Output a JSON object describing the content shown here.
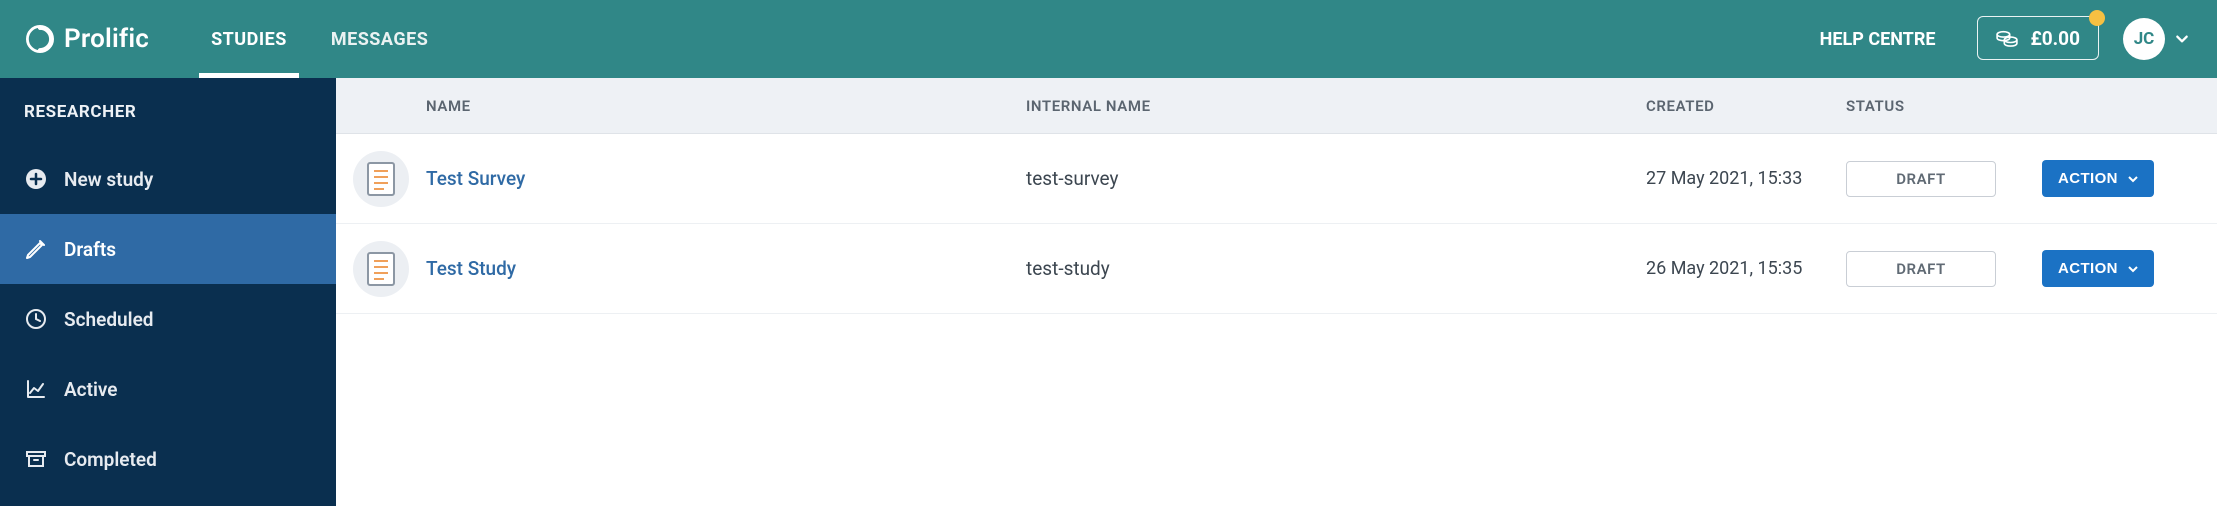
{
  "brand": {
    "name": "Prolific"
  },
  "topnav": {
    "studies": "STUDIES",
    "messages": "MESSAGES",
    "help_centre": "HELP CENTRE"
  },
  "balance": {
    "amount": "£0.00"
  },
  "user": {
    "initials": "JC"
  },
  "sidebar": {
    "heading": "RESEARCHER",
    "new_study": "New study",
    "drafts": "Drafts",
    "scheduled": "Scheduled",
    "active": "Active",
    "completed": "Completed"
  },
  "table": {
    "headers": {
      "name": "NAME",
      "internal_name": "INTERNAL NAME",
      "created": "CREATED",
      "status": "STATUS"
    }
  },
  "action_label": "ACTION",
  "rows": [
    {
      "name": "Test Survey",
      "internal_name": "test-survey",
      "created": "27 May 2021, 15:33",
      "status": "DRAFT"
    },
    {
      "name": "Test Study",
      "internal_name": "test-study",
      "created": "26 May 2021, 15:35",
      "status": "DRAFT"
    }
  ]
}
